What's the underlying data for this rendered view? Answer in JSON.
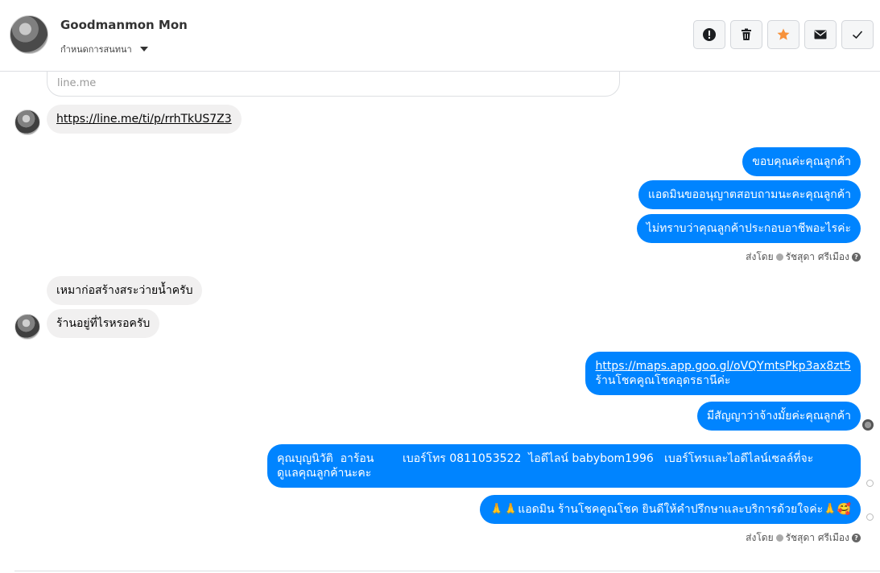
{
  "header": {
    "name": "Goodmanmon Mon",
    "assign_label": "กำหนดการสนทนา"
  },
  "link_preview": {
    "domain": "line.me"
  },
  "messages": {
    "m1": "https://line.me/ti/p/rrhTkUS7Z3",
    "m2": "ขอบคุณค่ะคุณลูกค้า",
    "m3": "แอดมินขออนุญาตสอบถามนะคะคุณลูกค้า",
    "m4": "ไม่ทราบว่าคุณลูกค้าประกอบอาชีพอะไรค่ะ",
    "m5": "เหมาก่อสร้างสระว่ายน้ำครับ",
    "m6": "ร้านอยู่ที่ไรหรอครับ",
    "m7_link": "https://maps.app.goo.gl/oVQYmtsPkp3ax8zt5",
    "m7_text": "ร้านโชคคูณโชคอุดรธานีค่ะ",
    "m8": "มีสัญญาว่าจ้างมั้ยค่ะคุณลูกค้า",
    "m9_line1": "คุณบุญนิวัติ  อาร้อน        เบอร์โทร 0811053522  ไอดีไลน์ babybom1996   เบอร์โทรและไอดีไลน์เซลล์ที่จะ",
    "m9_line2": "ดูแลคุณลูกค้านะคะ",
    "m10": "🙏🙏แอดมิน ร้านโชคคูณโชค ยินดีให้คำปรึกษาและบริการด้วยใจค่ะ🙏🥰"
  },
  "sent_by": {
    "prefix": "ส่งโดย",
    "agent": "รัชสุดา ศรีเมือง",
    "help": "?"
  },
  "colors": {
    "outgoing": "#0084ff",
    "incoming": "#f1f0f0",
    "star": "#f7923b"
  },
  "icons": [
    "alert-icon",
    "trash-icon",
    "star-icon",
    "mail-icon",
    "check-icon"
  ]
}
